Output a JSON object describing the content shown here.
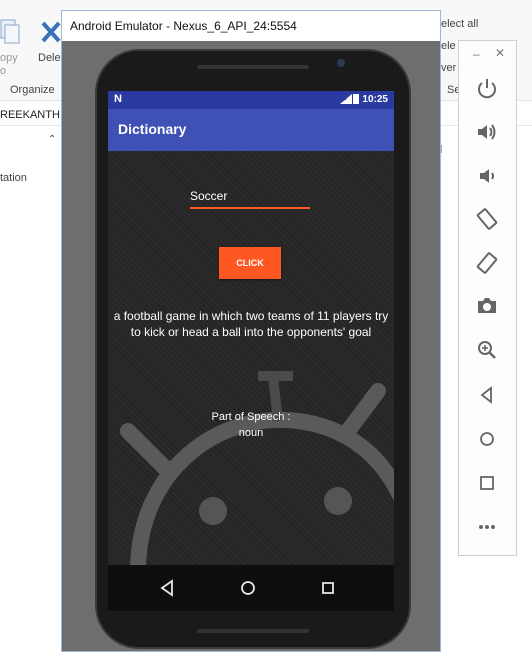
{
  "explorer": {
    "ribbon": {
      "copy_partial": "opy",
      "copy_sub_partial": "o",
      "delete_partial": "Dele",
      "select_all_partial": "elect all",
      "select_none_partial": "ele",
      "invert_partial": "ver",
      "organize": "Organize",
      "select_group_partial": "Se"
    },
    "address_partial": "REEKANTH",
    "sidebar_partial": "tation"
  },
  "emulator": {
    "title": "Android Emulator - Nexus_6_API_24:5554",
    "status_bar": {
      "time": "10:25"
    },
    "app_bar_title": "Dictionary",
    "word_input_value": "Soccer",
    "click_button_label": "CLICK",
    "definition": "a football game in which two teams of 11 players try to kick or head a ball into the opponents' goal",
    "part_of_speech_label": "Part of Speech :",
    "part_of_speech_value": "noun"
  },
  "toolbar": {
    "minimize": "–",
    "close": "✕",
    "buttons": [
      "power-icon",
      "volume-up-icon",
      "volume-down-icon",
      "rotate-left-icon",
      "rotate-right-icon",
      "camera-icon",
      "zoom-icon",
      "back-icon",
      "home-icon",
      "overview-icon",
      "more-icon"
    ]
  },
  "colors": {
    "accent": "#ff5722",
    "app_bar": "#3f51b5",
    "status_bar": "#2b3aa0"
  }
}
